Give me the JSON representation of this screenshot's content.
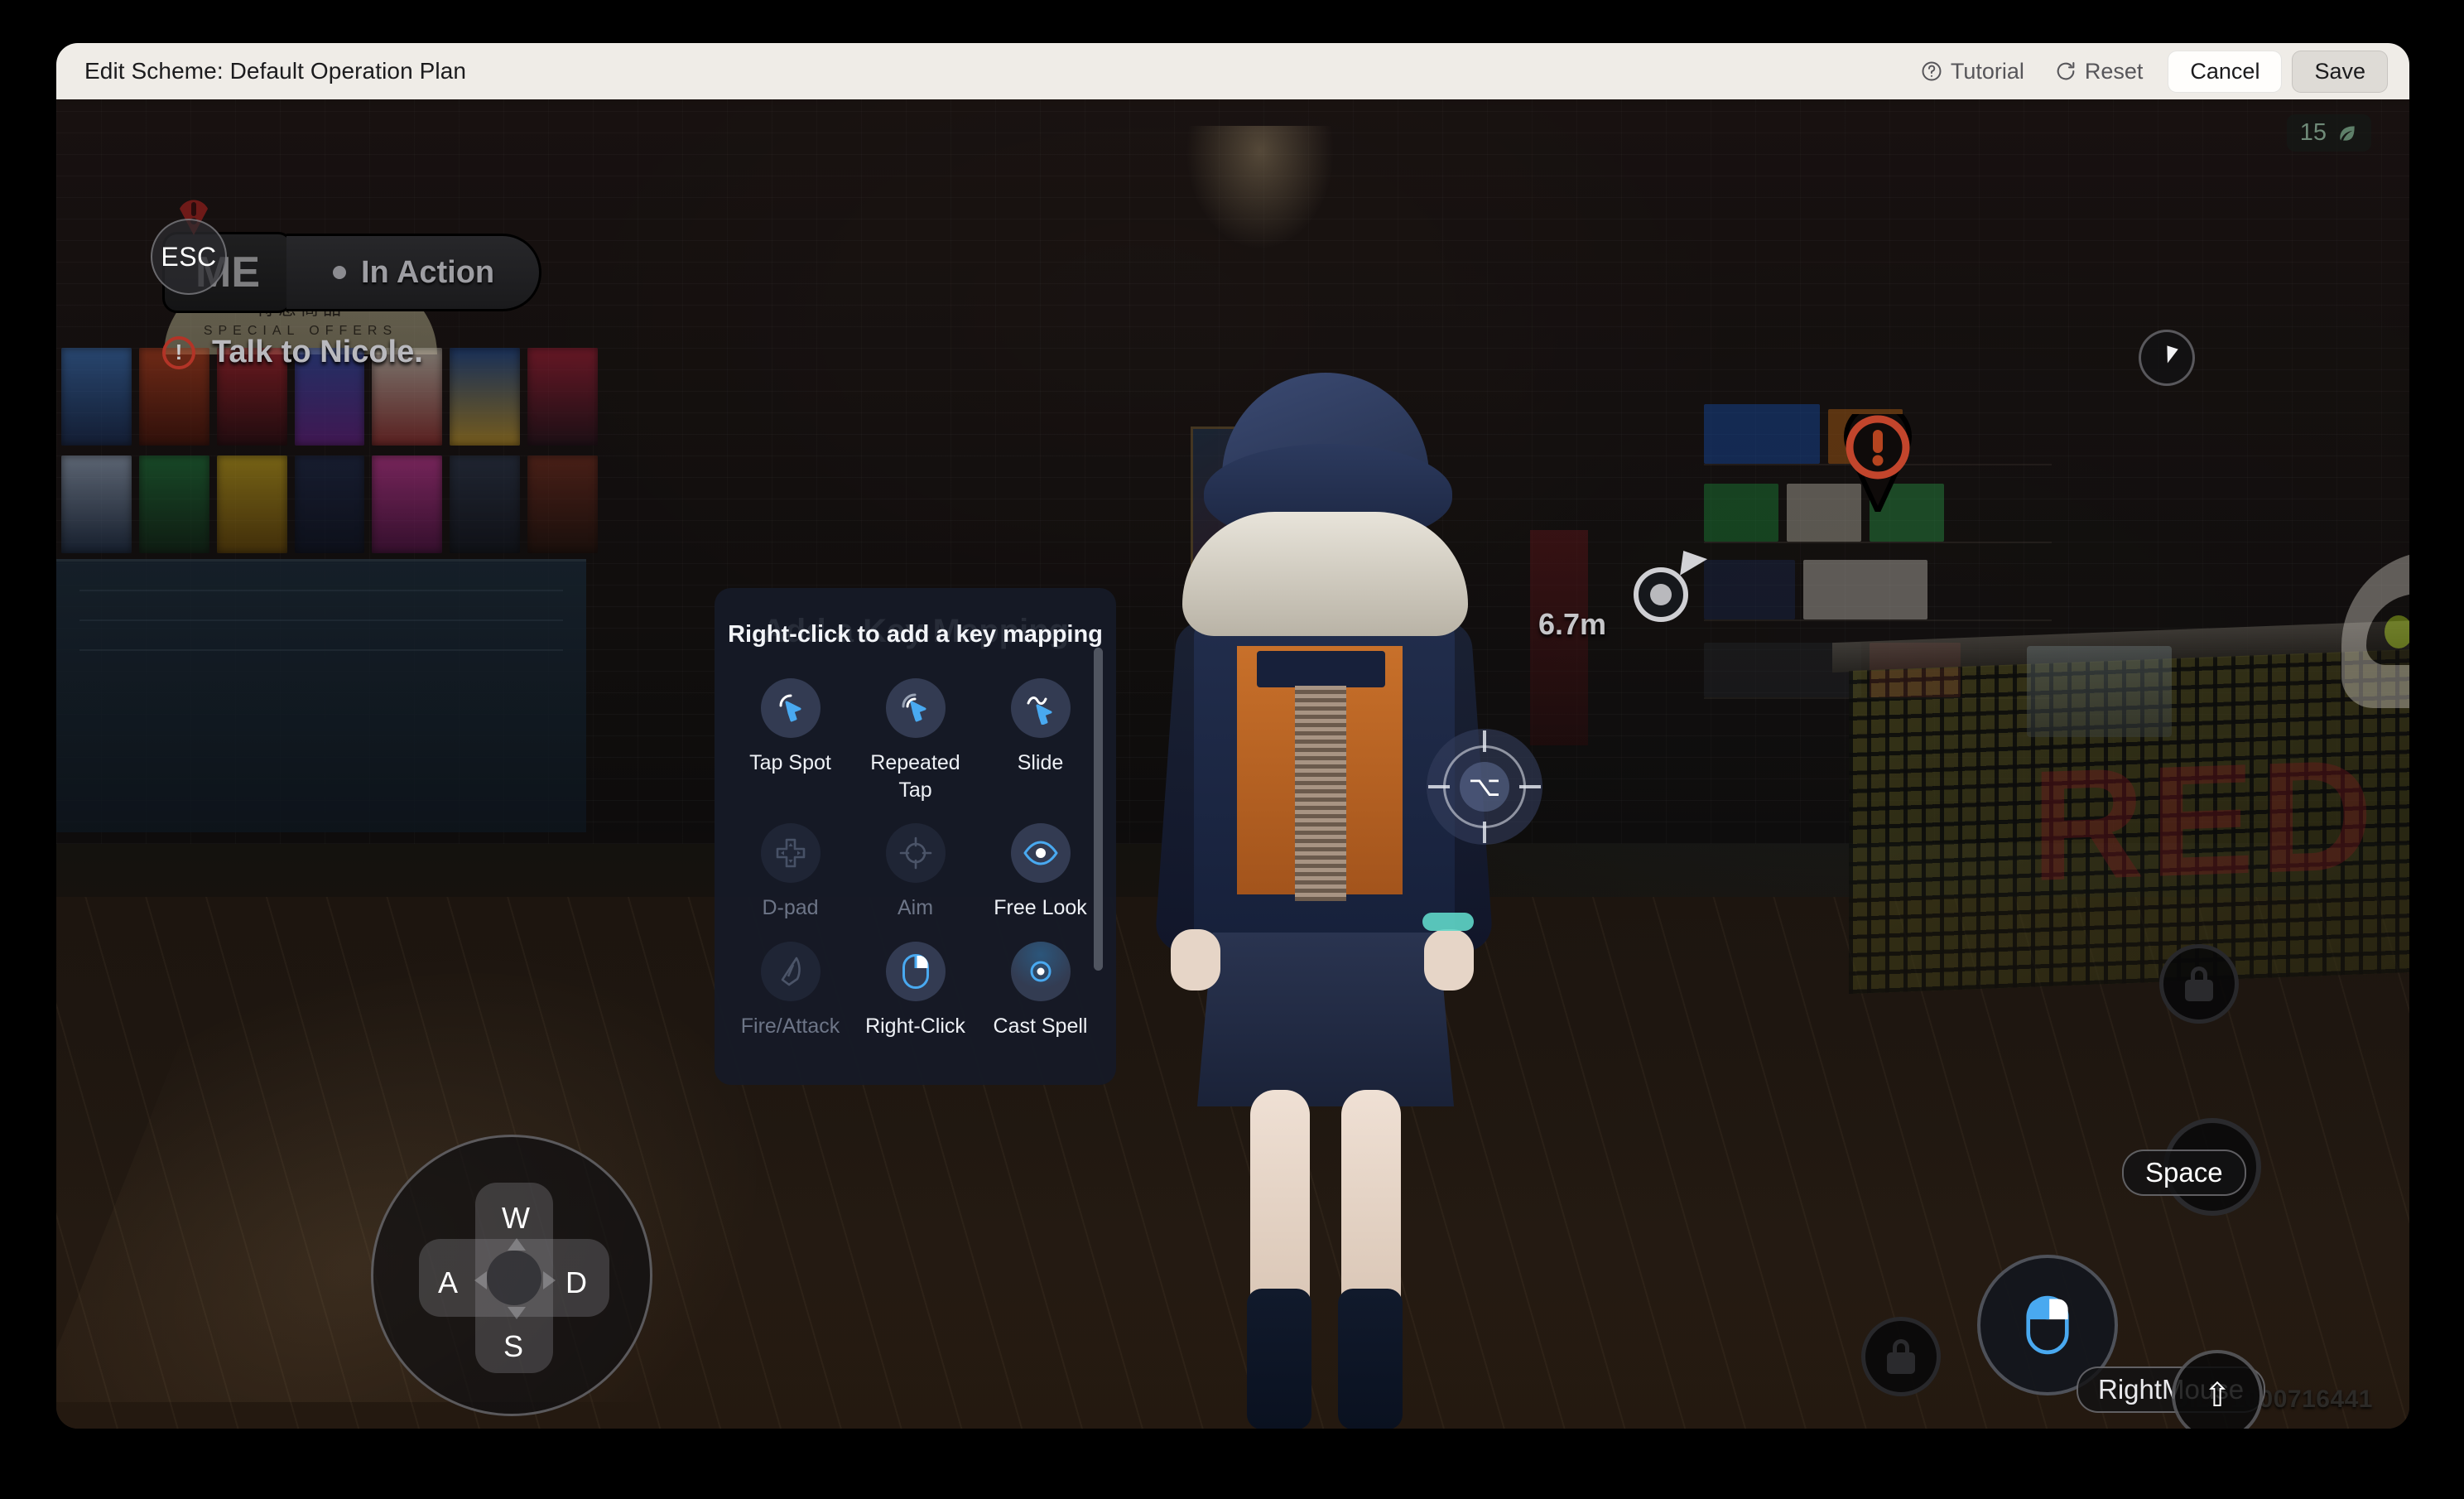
{
  "titlebar": {
    "title": "Edit Scheme: Default Operation Plan",
    "tutorial_label": "Tutorial",
    "reset_label": "Reset",
    "cancel_label": "Cancel",
    "save_label": "Save",
    "tutorial_icon": "question-circle-icon",
    "reset_icon": "refresh-icon"
  },
  "hud": {
    "esc_badge": "ESC",
    "quest_icon_text": "ME",
    "status_text": "In Action",
    "objective_text": "Talk to Nicole.",
    "objective_mark": "!",
    "leaf_count": "15",
    "leaf_icon": "leaf-icon",
    "uid_text": "UID: 1000716441",
    "distance_text": "6.7m",
    "quest_pin_icon": "exclamation-pin-icon",
    "cursor_dial_icon": "cursor-icon"
  },
  "controls": {
    "alt_reticle_key": "⌥",
    "dpad": {
      "up": "W",
      "left": "A",
      "right": "D",
      "down": "S"
    },
    "space_label": "Space",
    "rightmouse_label": "RightMouse",
    "shift_label": "⇧",
    "lock_icon": "lock-icon",
    "mouse_icon": "mouse-right-click-icon"
  },
  "map_panel": {
    "ghost_title": "Add a Key Mapping",
    "title": "Right-click to add a key mapping",
    "items": [
      {
        "label": "Tap Spot",
        "icon": "tap-spot-icon",
        "enabled": true
      },
      {
        "label": "Repeated Tap",
        "icon": "repeated-tap-icon",
        "enabled": true
      },
      {
        "label": "Slide",
        "icon": "slide-icon",
        "enabled": true
      },
      {
        "label": "D-pad",
        "icon": "dpad-icon",
        "enabled": false
      },
      {
        "label": "Aim",
        "icon": "aim-icon",
        "enabled": false
      },
      {
        "label": "Free Look",
        "icon": "free-look-icon",
        "enabled": true
      },
      {
        "label": "Fire/Attack",
        "icon": "fire-attack-icon",
        "enabled": false
      },
      {
        "label": "Right-Click",
        "icon": "right-click-icon",
        "enabled": true
      },
      {
        "label": "Cast Spell",
        "icon": "cast-spell-icon",
        "enabled": true
      }
    ]
  },
  "scene": {
    "shop_sign_line1": "特惠商品",
    "shop_sign_line2": "SPECIAL OFFERS",
    "counter_text": "RED"
  },
  "colors": {
    "accent": "#49a9f0",
    "titlebar_bg": "#efece7",
    "panel_bg": "#161a26",
    "quest_red": "#b33427"
  }
}
